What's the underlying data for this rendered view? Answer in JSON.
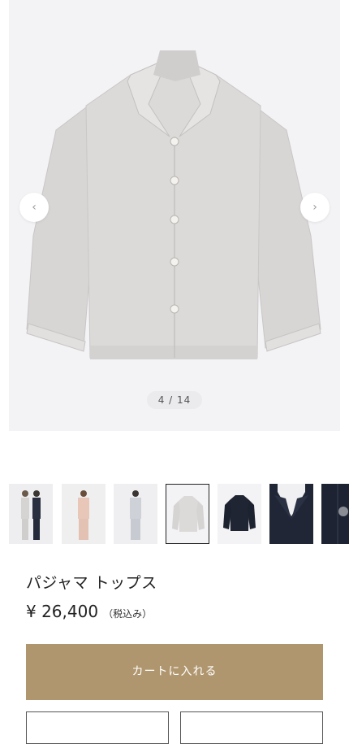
{
  "gallery": {
    "prev_icon": "‹",
    "next_icon": "›",
    "counter": "4 / 14",
    "current": 4,
    "total": 14
  },
  "thumbnails": [
    {
      "label": "couple-grey-navy"
    },
    {
      "label": "pink-set"
    },
    {
      "label": "grey-set-model"
    },
    {
      "label": "grey-top-flat",
      "active": true
    },
    {
      "label": "navy-top-flat"
    },
    {
      "label": "navy-collar-closeup"
    },
    {
      "label": "navy-button-closeup"
    }
  ],
  "product": {
    "title": "パジャマ トップス",
    "price": "¥ 26,400",
    "tax_note": "（税込み）"
  },
  "actions": {
    "cart_label": "カートに入れる"
  },
  "colors": {
    "accent": "#b0966e",
    "gallery_bg": "#f3f3f5",
    "garment_grey": "#d9d6d6",
    "navy": "#1f2533"
  }
}
